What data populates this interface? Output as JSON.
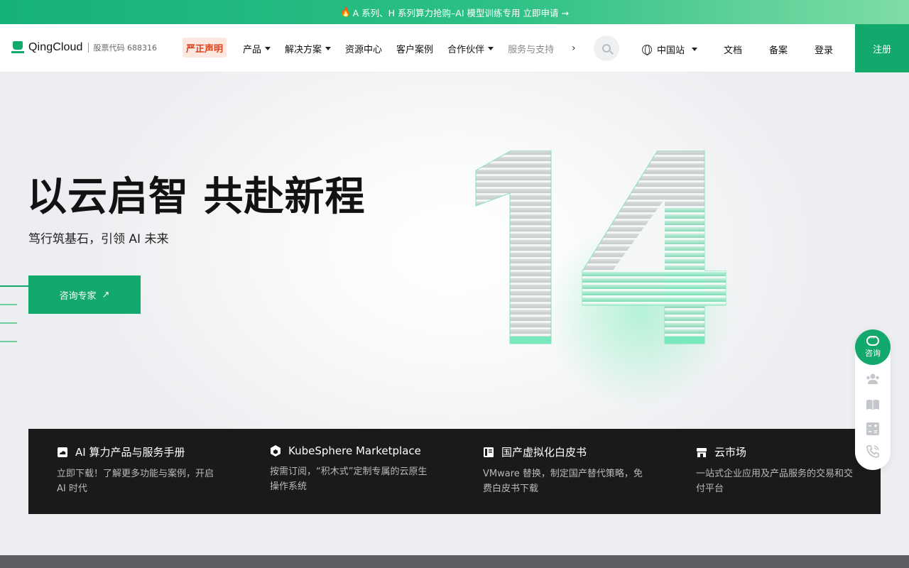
{
  "promo": {
    "text": "A 系列、H 系列算力抢购–AI 模型训练专用 立即申请 →",
    "icon": "fire-icon"
  },
  "brand": {
    "name": "QingCloud",
    "stock": "股票代码 688316",
    "color": "#13a86c"
  },
  "nav": {
    "notice": "严正声明",
    "items": [
      {
        "label": "产品",
        "has_caret": true
      },
      {
        "label": "解决方案",
        "has_caret": true
      },
      {
        "label": "资源中心",
        "has_caret": false
      },
      {
        "label": "客户案例",
        "has_caret": false
      },
      {
        "label": "合作伙伴",
        "has_caret": true
      },
      {
        "label": "服务与支持",
        "has_caret": false
      }
    ],
    "more": "›",
    "region": "中国站",
    "docs": "文档",
    "beian": "备案",
    "login": "登录",
    "signup": "注册"
  },
  "hero": {
    "title": "以云启智 共赴新程",
    "subtitle": "笃行筑基石，引领 AI 未来",
    "cta": "咨询专家",
    "cta_arrow": "↗",
    "art_text": "14"
  },
  "features": [
    {
      "icon": "cloud-box-icon",
      "title": "AI 算力产品与服务手册",
      "desc": "立即下载！了解更多功能与案例，开启 AI 时代"
    },
    {
      "icon": "cube-icon",
      "title": "KubeSphere Marketplace",
      "desc": "按需订阅，“积木式”定制专属的云原生操作系统"
    },
    {
      "icon": "book-icon",
      "title": "国产虚拟化白皮书",
      "desc": "VMware 替换，制定国产替代策略，免费白皮书下载"
    },
    {
      "icon": "store-icon",
      "title": "云市场",
      "desc": "一站式企业应用及产品服务的交易和交付平台"
    }
  ],
  "float_widget": {
    "consult": "咨询",
    "icons": [
      "users-icon",
      "book-open-icon",
      "calculator-icon",
      "phone-icon"
    ]
  }
}
